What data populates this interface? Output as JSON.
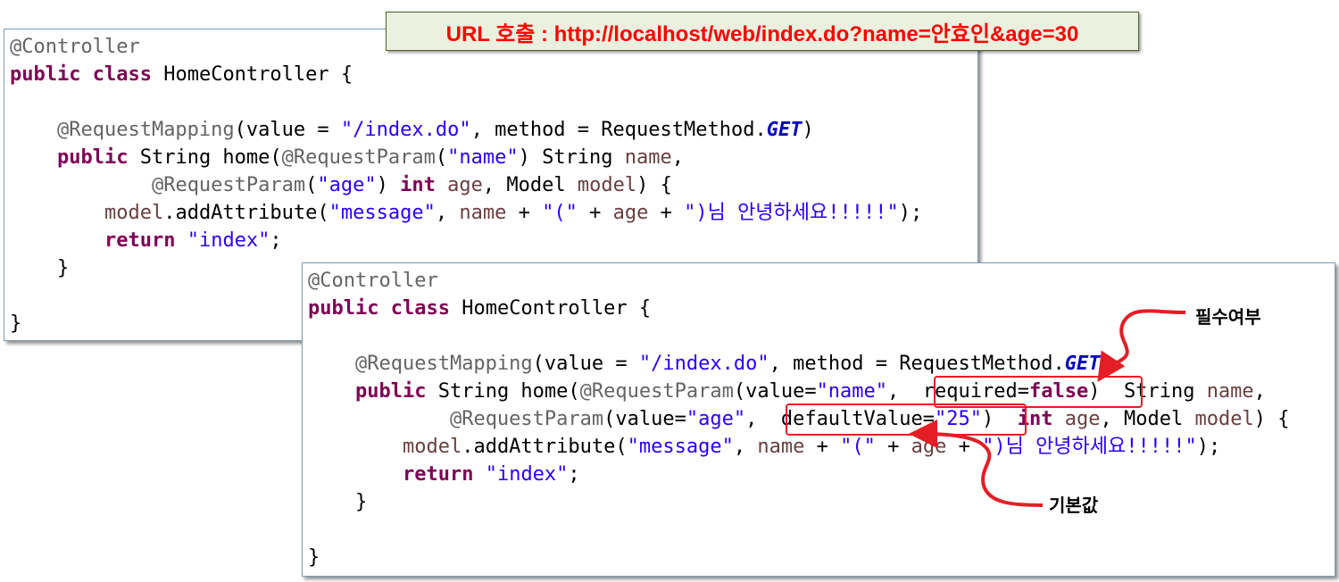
{
  "url_banner": "URL 호출 : http://localhost/web/index.do?name=안효인&age=30",
  "panel1": {
    "lines": [
      [
        {
          "c": "ann",
          "t": "@Controller"
        }
      ],
      [
        {
          "c": "kw",
          "t": "public"
        },
        {
          "c": "",
          "t": " "
        },
        {
          "c": "kw",
          "t": "class"
        },
        {
          "c": "",
          "t": " HomeController {"
        }
      ],
      [
        {
          "c": "",
          "t": ""
        }
      ],
      [
        {
          "c": "",
          "t": "    "
        },
        {
          "c": "ann",
          "t": "@RequestMapping"
        },
        {
          "c": "",
          "t": "(value = "
        },
        {
          "c": "str",
          "t": "\"/index.do\""
        },
        {
          "c": "",
          "t": ", method = RequestMethod."
        },
        {
          "c": "italic",
          "t": "GET"
        },
        {
          "c": "",
          "t": ")"
        }
      ],
      [
        {
          "c": "",
          "t": "    "
        },
        {
          "c": "kw",
          "t": "public"
        },
        {
          "c": "",
          "t": " String home("
        },
        {
          "c": "ann",
          "t": "@RequestParam"
        },
        {
          "c": "",
          "t": "("
        },
        {
          "c": "str",
          "t": "\"name\""
        },
        {
          "c": "",
          "t": ") String "
        },
        {
          "c": "var",
          "t": "name"
        },
        {
          "c": "",
          "t": ","
        }
      ],
      [
        {
          "c": "",
          "t": "            "
        },
        {
          "c": "ann",
          "t": "@RequestParam"
        },
        {
          "c": "",
          "t": "("
        },
        {
          "c": "str",
          "t": "\"age\""
        },
        {
          "c": "",
          "t": ") "
        },
        {
          "c": "kw",
          "t": "int"
        },
        {
          "c": "",
          "t": " "
        },
        {
          "c": "var",
          "t": "age"
        },
        {
          "c": "",
          "t": ", Model "
        },
        {
          "c": "var",
          "t": "model"
        },
        {
          "c": "",
          "t": ") {"
        }
      ],
      [
        {
          "c": "",
          "t": "        "
        },
        {
          "c": "var",
          "t": "model"
        },
        {
          "c": "",
          "t": ".addAttribute("
        },
        {
          "c": "str",
          "t": "\"message\""
        },
        {
          "c": "",
          "t": ", "
        },
        {
          "c": "var",
          "t": "name"
        },
        {
          "c": "",
          "t": " + "
        },
        {
          "c": "str",
          "t": "\"(\""
        },
        {
          "c": "",
          "t": " + "
        },
        {
          "c": "var",
          "t": "age"
        },
        {
          "c": "",
          "t": " + "
        },
        {
          "c": "str",
          "t": "\")님 안녕하세요!!!!!\""
        },
        {
          "c": "",
          "t": ");"
        }
      ],
      [
        {
          "c": "",
          "t": "        "
        },
        {
          "c": "kw",
          "t": "return"
        },
        {
          "c": "",
          "t": " "
        },
        {
          "c": "str",
          "t": "\"index\""
        },
        {
          "c": "",
          "t": ";"
        }
      ],
      [
        {
          "c": "",
          "t": "    }"
        }
      ],
      [
        {
          "c": "",
          "t": ""
        }
      ],
      [
        {
          "c": "",
          "t": "}"
        }
      ]
    ]
  },
  "panel2": {
    "lines": [
      [
        {
          "c": "ann",
          "t": "@Controller"
        }
      ],
      [
        {
          "c": "kw",
          "t": "public"
        },
        {
          "c": "",
          "t": " "
        },
        {
          "c": "kw",
          "t": "class"
        },
        {
          "c": "",
          "t": " HomeController {"
        }
      ],
      [
        {
          "c": "",
          "t": ""
        }
      ],
      [
        {
          "c": "",
          "t": "    "
        },
        {
          "c": "ann",
          "t": "@RequestMapping"
        },
        {
          "c": "",
          "t": "(value = "
        },
        {
          "c": "str",
          "t": "\"/index.do\""
        },
        {
          "c": "",
          "t": ", method = RequestMethod."
        },
        {
          "c": "italic",
          "t": "GET"
        },
        {
          "c": "",
          "t": ")"
        }
      ],
      [
        {
          "c": "",
          "t": "    "
        },
        {
          "c": "kw",
          "t": "public"
        },
        {
          "c": "",
          "t": " String home("
        },
        {
          "c": "ann",
          "t": "@RequestParam"
        },
        {
          "c": "",
          "t": "(value="
        },
        {
          "c": "str",
          "t": "\"name\""
        },
        {
          "c": "",
          "t": ",  required="
        },
        {
          "c": "kw",
          "t": "false"
        },
        {
          "c": "",
          "t": ")  String "
        },
        {
          "c": "var",
          "t": "name"
        },
        {
          "c": "",
          "t": ","
        }
      ],
      [
        {
          "c": "",
          "t": "            "
        },
        {
          "c": "ann",
          "t": "@RequestParam"
        },
        {
          "c": "",
          "t": "(value="
        },
        {
          "c": "str",
          "t": "\"age\""
        },
        {
          "c": "",
          "t": ",  defaultValue="
        },
        {
          "c": "str",
          "t": "\"25\""
        },
        {
          "c": "",
          "t": ")  "
        },
        {
          "c": "kw",
          "t": "int"
        },
        {
          "c": "",
          "t": " "
        },
        {
          "c": "var",
          "t": "age"
        },
        {
          "c": "",
          "t": ", Model "
        },
        {
          "c": "var",
          "t": "model"
        },
        {
          "c": "",
          "t": ") {"
        }
      ],
      [
        {
          "c": "",
          "t": "        "
        },
        {
          "c": "var",
          "t": "model"
        },
        {
          "c": "",
          "t": ".addAttribute("
        },
        {
          "c": "str",
          "t": "\"message\""
        },
        {
          "c": "",
          "t": ", "
        },
        {
          "c": "var",
          "t": "name"
        },
        {
          "c": "",
          "t": " + "
        },
        {
          "c": "str",
          "t": "\"(\""
        },
        {
          "c": "",
          "t": " + "
        },
        {
          "c": "var",
          "t": "age"
        },
        {
          "c": "",
          "t": " + "
        },
        {
          "c": "str",
          "t": "\")님 안녕하세요!!!!!\""
        },
        {
          "c": "",
          "t": ");"
        }
      ],
      [
        {
          "c": "",
          "t": "        "
        },
        {
          "c": "kw",
          "t": "return"
        },
        {
          "c": "",
          "t": " "
        },
        {
          "c": "str",
          "t": "\"index\""
        },
        {
          "c": "",
          "t": ";"
        }
      ],
      [
        {
          "c": "",
          "t": "    }"
        }
      ],
      [
        {
          "c": "",
          "t": ""
        }
      ],
      [
        {
          "c": "",
          "t": "}"
        }
      ]
    ]
  },
  "callouts": {
    "required": "필수여부",
    "default": "기본값"
  },
  "colors": {
    "highlight": "#e31e24",
    "banner_text": "#ff0000",
    "banner_bg": "#ebf1de"
  }
}
